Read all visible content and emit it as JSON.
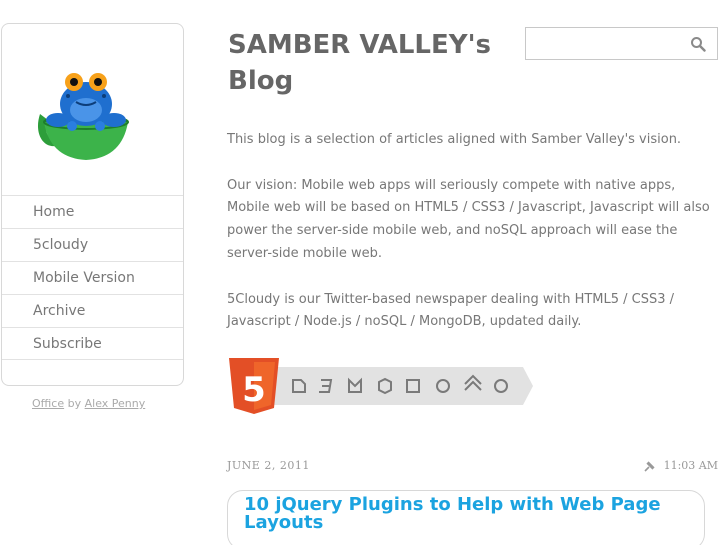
{
  "header": {
    "blog_title": "SAMBER VALLEY's Blog",
    "search_placeholder": ""
  },
  "sidebar": {
    "logo": "frog-in-teacup-logo",
    "items": [
      {
        "label": "Home"
      },
      {
        "label": "5cloudy"
      },
      {
        "label": "Mobile Version"
      },
      {
        "label": "Archive"
      },
      {
        "label": "Subscribe"
      }
    ],
    "credit": {
      "theme": "Office",
      "by": "by",
      "author": "Alex Penny"
    }
  },
  "intro": {
    "p1": "This blog is a selection of articles aligned with Samber Valley's vision.",
    "p2": "Our vision: Mobile web apps will seriously compete with native apps, Mobile web will be based on HTML5 / CSS3 / Javascript, Javascript will also power the server-side mobile web, and noSQL approach will ease the server-side mobile web.",
    "p3": "5Cloudy is our Twitter-based newspaper dealing with HTML5 / CSS3 / Javascript / Node.js / noSQL / MongoDB, updated daily."
  },
  "badge": {
    "name": "html5-technology-badge",
    "glyph": "5",
    "colors": {
      "shield": "#e34f26",
      "shield_light": "#ef652a",
      "ribbon": "#e0e0e0",
      "ribbon_icons": "#7a7a7a"
    }
  },
  "post": {
    "date": "JUNE 2, 2011",
    "time": "11:03 AM",
    "title": "10 jQuery Plugins to Help with Web Page Layouts"
  },
  "colors": {
    "link_blue": "#1ba3e0",
    "text": "#777777",
    "title": "#666666",
    "border": "#d8d8d8"
  }
}
